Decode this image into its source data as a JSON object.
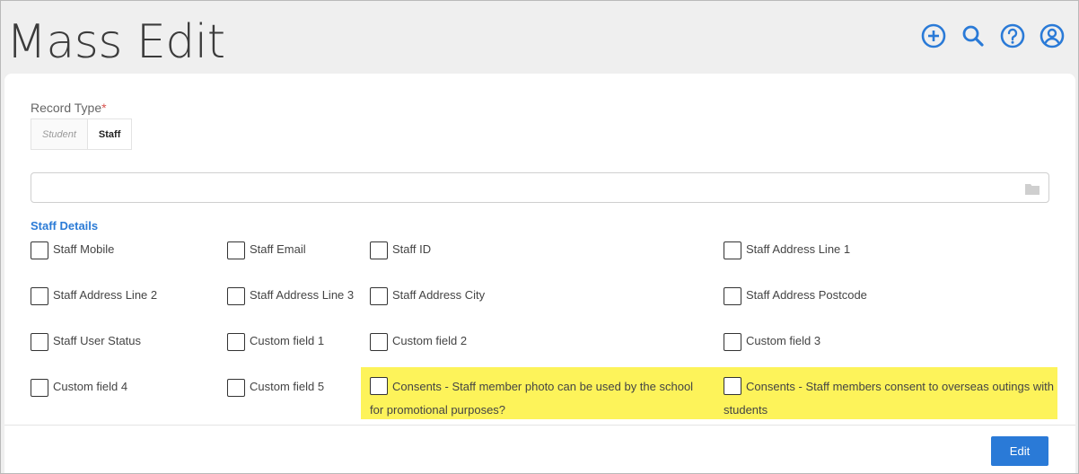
{
  "header": {
    "title": "Mass Edit",
    "icons": [
      "add-circle-icon",
      "search-icon",
      "help-icon",
      "account-icon"
    ],
    "icon_color": "#2a7ad7"
  },
  "form": {
    "record_type_label": "Record Type",
    "required_marker": "*",
    "record_types": [
      {
        "label": "Student",
        "selected": false
      },
      {
        "label": "Staff",
        "selected": true
      }
    ],
    "search_value": ""
  },
  "section": {
    "title": "Staff Details",
    "fields": [
      {
        "label": "Staff Mobile",
        "checked": false
      },
      {
        "label": "Staff Email",
        "checked": false
      },
      {
        "label": "Staff ID",
        "checked": false
      },
      {
        "label": "Staff Address Line 1",
        "checked": false
      },
      {
        "label": "Staff Address Line 2",
        "checked": false
      },
      {
        "label": "Staff Address Line 3",
        "checked": false
      },
      {
        "label": "Staff Address City",
        "checked": false
      },
      {
        "label": "Staff Address Postcode",
        "checked": false
      },
      {
        "label": "Staff User Status",
        "checked": false
      },
      {
        "label": "Custom field 1",
        "checked": false
      },
      {
        "label": "Custom field 2",
        "checked": false
      },
      {
        "label": "Custom field 3",
        "checked": false
      },
      {
        "label": "Custom field 4",
        "checked": false
      },
      {
        "label": "Custom field 5",
        "checked": false
      },
      {
        "label": "Consents - Staff member photo can be used by the school for promotional purposes?",
        "checked": false,
        "highlighted": true
      },
      {
        "label": "Consents - Staff members consent to overseas outings with students",
        "checked": false,
        "highlighted": true
      }
    ],
    "highlight_color": "#fdf35a"
  },
  "footer": {
    "edit_label": "Edit"
  }
}
